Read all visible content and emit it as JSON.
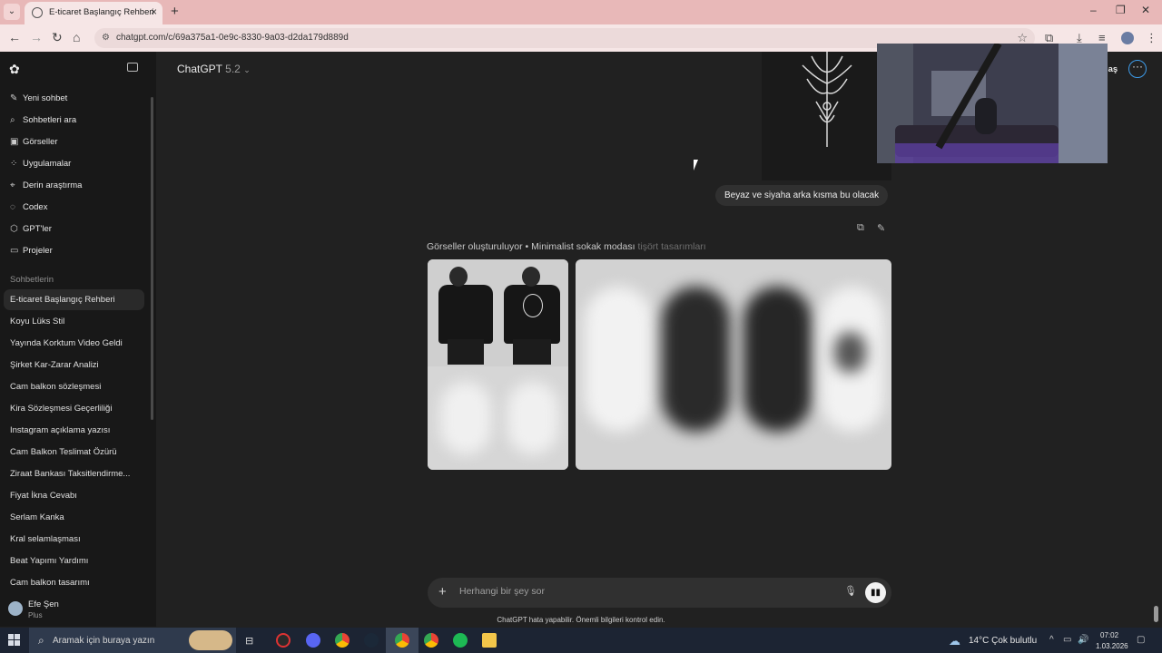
{
  "browser": {
    "tab_title": "E-ticaret Başlangıç Rehberi",
    "url": "chatgpt.com/c/69a375a1-0e9c-8330-9a03-d2da179d889d"
  },
  "sidebar": {
    "items": [
      {
        "icon": "edit-icon",
        "label": "Yeni sohbet"
      },
      {
        "icon": "search-icon",
        "label": "Sohbetleri ara"
      },
      {
        "icon": "image-icon",
        "label": "Görseller"
      },
      {
        "icon": "apps-icon",
        "label": "Uygulamalar"
      },
      {
        "icon": "telescope-icon",
        "label": "Derin araştırma"
      },
      {
        "icon": "code-icon",
        "label": "Codex"
      },
      {
        "icon": "gpt-icon",
        "label": "GPT'ler"
      },
      {
        "icon": "folder-icon",
        "label": "Projeler"
      }
    ],
    "section_title": "Sohbetlerin",
    "chats": [
      "E-ticaret Başlangıç Rehberi",
      "Koyu Lüks Stil",
      "Yayında Korktum Video Geldi",
      "Şirket Kar-Zarar Analizi",
      "Cam balkon sözleşmesi",
      "Kira Sözleşmesi Geçerliliği",
      "Instagram açıklama yazısı",
      "Cam Balkon Teslimat Özürü",
      "Ziraat Bankası Taksitlendirme...",
      "Fiyat İkna Cevabı",
      "Serlam Kanka",
      "Kral selamlaşması",
      "Beat Yapımı Yardımı",
      "Cam balkon tasarımı"
    ],
    "user": {
      "name": "Efe Şen",
      "plan": "Plus"
    }
  },
  "header": {
    "model_name": "ChatGPT",
    "model_version": "5.2",
    "share_label": "laş"
  },
  "conversation": {
    "user_message": "Beyaz ve siyaha arka kısma bu olacak",
    "generation_status": "Görseller oluşturuluyor • Minimalist sokak modası",
    "generation_status_faded": "tişört tasarımları"
  },
  "composer": {
    "placeholder": "Herhangi bir şey sor",
    "disclaimer": "ChatGPT hata yapabilir. Önemli bilgileri kontrol edin."
  },
  "taskbar": {
    "search_placeholder": "Aramak için buraya yazın",
    "weather": "14°C  Çok bulutlu",
    "time": "07:02",
    "date": "1.03.2026"
  }
}
